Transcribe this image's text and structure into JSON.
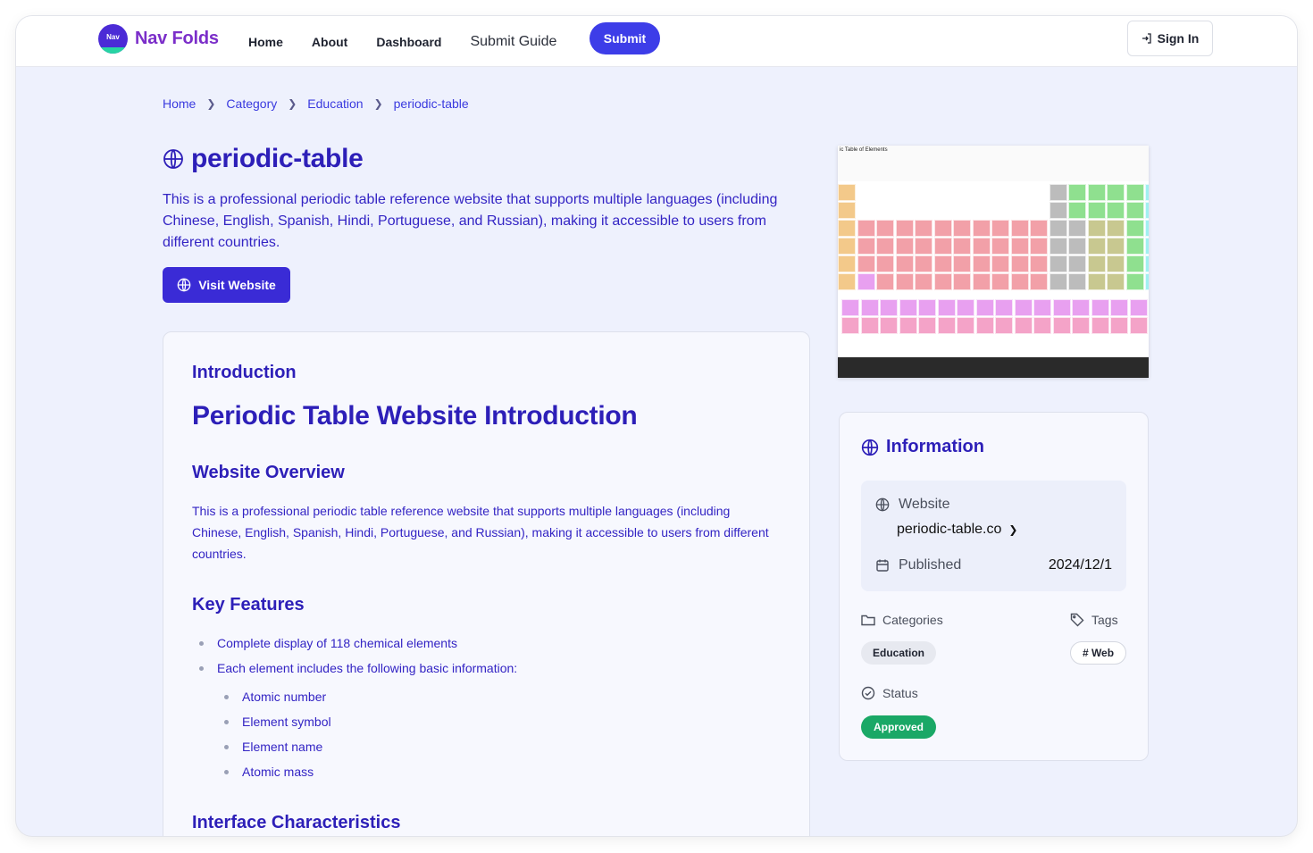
{
  "brand": {
    "logo_badge": "Nav",
    "name": "Nav Folds"
  },
  "nav": {
    "items": [
      "Home",
      "About",
      "Dashboard"
    ],
    "guide": "Submit Guide",
    "submit": "Submit",
    "signin": "Sign In"
  },
  "breadcrumb": [
    "Home",
    "Category",
    "Education",
    "periodic-table"
  ],
  "page": {
    "title": "periodic-table",
    "lead": "This is a professional periodic table reference website that supports multiple languages (including Chinese, English, Spanish, Hindi, Portuguese, and Russian), making it accessible to users from different countries.",
    "visit": "Visit Website"
  },
  "preview": {
    "caption": "ic Table of Elements"
  },
  "article": {
    "section": "Introduction",
    "heading": "Periodic Table Website Introduction",
    "overview_heading": "Website Overview",
    "overview_text": "This is a professional periodic table reference website that supports multiple languages (including Chinese, English, Spanish, Hindi, Portuguese, and Russian), making it accessible to users from different countries.",
    "features_heading": "Key Features",
    "features": [
      "Complete display of 118 chemical elements",
      "Each element includes the following basic information:"
    ],
    "sub_features": [
      "Atomic number",
      "Element symbol",
      "Element name",
      "Atomic mass"
    ],
    "interface_heading": "Interface Characteristics"
  },
  "info": {
    "title": "Information",
    "website_label": "Website",
    "website_value": "periodic-table.co",
    "published_label": "Published",
    "published_value": "2024/12/1",
    "categories_label": "Categories",
    "tags_label": "Tags",
    "category": "Education",
    "tag": "# Web",
    "status_label": "Status",
    "status": "Approved"
  },
  "colors": {
    "accent": "#3a2bd6",
    "heading": "#2d1fb8",
    "status": "#1aa866"
  }
}
